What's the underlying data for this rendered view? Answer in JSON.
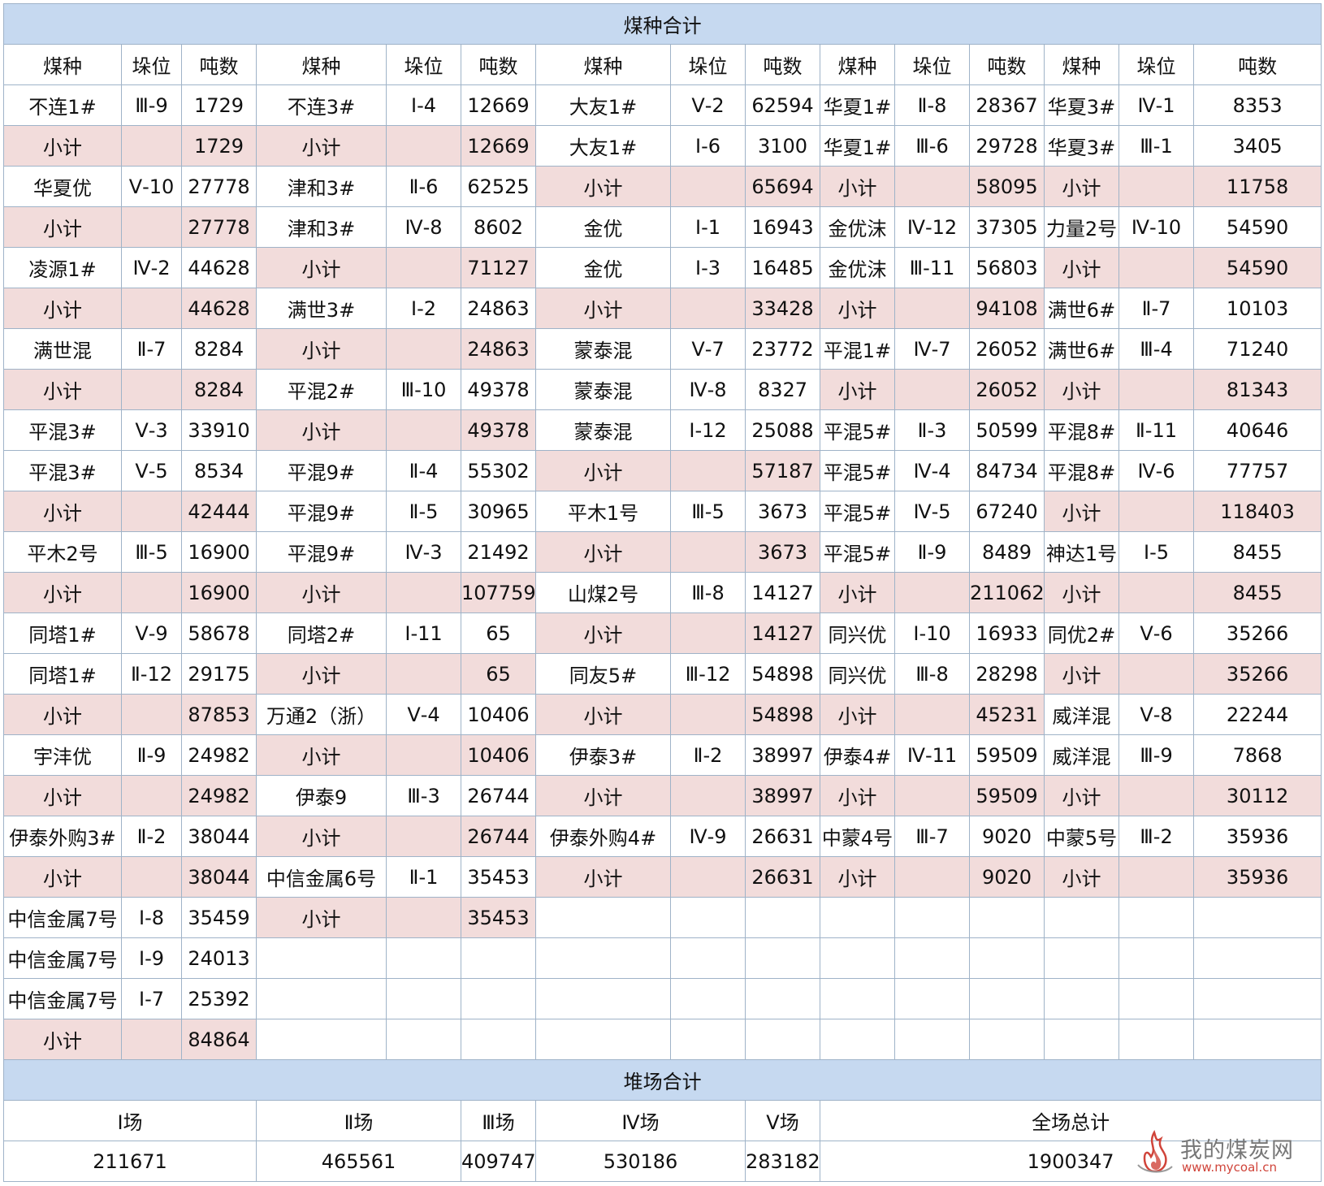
{
  "title": "煤种合计",
  "headers": [
    "煤种",
    "垛位",
    "吨数",
    "煤种",
    "垛位",
    "吨数",
    "煤种",
    "垛位",
    "吨数",
    "煤种",
    "垛位",
    "吨数",
    "煤种",
    "垛位",
    "吨数"
  ],
  "rows": [
    [
      "不连1#",
      "Ⅲ-9",
      "1729",
      "不连3#",
      "Ⅰ-4",
      "12669",
      "大友1#",
      "Ⅴ-2",
      "62594",
      "华夏1#",
      "Ⅱ-8",
      "28367",
      "华夏3#",
      "Ⅳ-1",
      "8353"
    ],
    [
      "小计",
      "",
      "1729",
      "小计",
      "",
      "12669",
      "大友1#",
      "Ⅰ-6",
      "3100",
      "华夏1#",
      "Ⅲ-6",
      "29728",
      "华夏3#",
      "Ⅲ-1",
      "3405"
    ],
    [
      "华夏优",
      "Ⅴ-10",
      "27778",
      "津和3#",
      "Ⅱ-6",
      "62525",
      "小计",
      "",
      "65694",
      "小计",
      "",
      "58095",
      "小计",
      "",
      "11758"
    ],
    [
      "小计",
      "",
      "27778",
      "津和3#",
      "Ⅳ-8",
      "8602",
      "金优",
      "Ⅰ-1",
      "16943",
      "金优沫",
      "Ⅳ-12",
      "37305",
      "力量2号",
      "Ⅳ-10",
      "54590"
    ],
    [
      "凌源1#",
      "Ⅳ-2",
      "44628",
      "小计",
      "",
      "71127",
      "金优",
      "Ⅰ-3",
      "16485",
      "金优沫",
      "Ⅲ-11",
      "56803",
      "小计",
      "",
      "54590"
    ],
    [
      "小计",
      "",
      "44628",
      "满世3#",
      "Ⅰ-2",
      "24863",
      "小计",
      "",
      "33428",
      "小计",
      "",
      "94108",
      "满世6#",
      "Ⅱ-7",
      "10103"
    ],
    [
      "满世混",
      "Ⅱ-7",
      "8284",
      "小计",
      "",
      "24863",
      "蒙泰混",
      "Ⅴ-7",
      "23772",
      "平混1#",
      "Ⅳ-7",
      "26052",
      "满世6#",
      "Ⅲ-4",
      "71240"
    ],
    [
      "小计",
      "",
      "8284",
      "平混2#",
      "Ⅲ-10",
      "49378",
      "蒙泰混",
      "Ⅳ-8",
      "8327",
      "小计",
      "",
      "26052",
      "小计",
      "",
      "81343"
    ],
    [
      "平混3#",
      "Ⅴ-3",
      "33910",
      "小计",
      "",
      "49378",
      "蒙泰混",
      "Ⅰ-12",
      "25088",
      "平混5#",
      "Ⅱ-3",
      "50599",
      "平混8#",
      "Ⅱ-11",
      "40646"
    ],
    [
      "平混3#",
      "Ⅴ-5",
      "8534",
      "平混9#",
      "Ⅱ-4",
      "55302",
      "小计",
      "",
      "57187",
      "平混5#",
      "Ⅳ-4",
      "84734",
      "平混8#",
      "Ⅳ-6",
      "77757"
    ],
    [
      "小计",
      "",
      "42444",
      "平混9#",
      "Ⅱ-5",
      "30965",
      "平木1号",
      "Ⅲ-5",
      "3673",
      "平混5#",
      "Ⅳ-5",
      "67240",
      "小计",
      "",
      "118403"
    ],
    [
      "平木2号",
      "Ⅲ-5",
      "16900",
      "平混9#",
      "Ⅳ-3",
      "21492",
      "小计",
      "",
      "3673",
      "平混5#",
      "Ⅱ-9",
      "8489",
      "神达1号",
      "Ⅰ-5",
      "8455"
    ],
    [
      "小计",
      "",
      "16900",
      "小计",
      "",
      "107759",
      "山煤2号",
      "Ⅲ-8",
      "14127",
      "小计",
      "",
      "211062",
      "小计",
      "",
      "8455"
    ],
    [
      "同塔1#",
      "Ⅴ-9",
      "58678",
      "同塔2#",
      "Ⅰ-11",
      "65",
      "小计",
      "",
      "14127",
      "同兴优",
      "Ⅰ-10",
      "16933",
      "同优2#",
      "Ⅴ-6",
      "35266"
    ],
    [
      "同塔1#",
      "Ⅱ-12",
      "29175",
      "小计",
      "",
      "65",
      "同友5#",
      "Ⅲ-12",
      "54898",
      "同兴优",
      "Ⅲ-8",
      "28298",
      "小计",
      "",
      "35266"
    ],
    [
      "小计",
      "",
      "87853",
      "万通2（浙）",
      "Ⅴ-4",
      "10406",
      "小计",
      "",
      "54898",
      "小计",
      "",
      "45231",
      "威洋混",
      "Ⅴ-8",
      "22244"
    ],
    [
      "宇沣优",
      "Ⅱ-9",
      "24982",
      "小计",
      "",
      "10406",
      "伊泰3#",
      "Ⅱ-2",
      "38997",
      "伊泰4#",
      "Ⅳ-11",
      "59509",
      "威洋混",
      "Ⅲ-9",
      "7868"
    ],
    [
      "小计",
      "",
      "24982",
      "伊泰9",
      "Ⅲ-3",
      "26744",
      "小计",
      "",
      "38997",
      "小计",
      "",
      "59509",
      "小计",
      "",
      "30112"
    ],
    [
      "伊泰外购3#",
      "Ⅱ-2",
      "38044",
      "小计",
      "",
      "26744",
      "伊泰外购4#",
      "Ⅳ-9",
      "26631",
      "中蒙4号",
      "Ⅲ-7",
      "9020",
      "中蒙5号",
      "Ⅲ-2",
      "35936"
    ],
    [
      "小计",
      "",
      "38044",
      "中信金属6号",
      "Ⅱ-1",
      "35453",
      "小计",
      "",
      "26631",
      "小计",
      "",
      "9020",
      "小计",
      "",
      "35936"
    ],
    [
      "中信金属7号",
      "Ⅰ-8",
      "35459",
      "小计",
      "",
      "35453",
      "",
      "",
      "",
      "",
      "",
      "",
      "",
      "",
      ""
    ],
    [
      "中信金属7号",
      "Ⅰ-9",
      "24013",
      "",
      "",
      "",
      "",
      "",
      "",
      "",
      "",
      "",
      "",
      "",
      ""
    ],
    [
      "中信金属7号",
      "Ⅰ-7",
      "25392",
      "",
      "",
      "",
      "",
      "",
      "",
      "",
      "",
      "",
      "",
      "",
      ""
    ],
    [
      "小计",
      "",
      "84864",
      "",
      "",
      "",
      "",
      "",
      "",
      "",
      "",
      "",
      "",
      "",
      ""
    ]
  ],
  "yard": {
    "title": "堆场合计",
    "labels": [
      "Ⅰ场",
      "Ⅱ场",
      "Ⅲ场",
      "Ⅳ场",
      "Ⅴ场",
      "全场总计"
    ],
    "values": [
      "211671",
      "465561",
      "409747",
      "530186",
      "283182",
      "1900347"
    ]
  },
  "watermark": {
    "text": "我的煤炭网",
    "url": "www.mycoal.cn",
    "icon": "flame-logo-icon"
  },
  "colors": {
    "header": "#c6d9f0",
    "subtotal": "#f2dcdb",
    "border": "#9fb3c8"
  }
}
